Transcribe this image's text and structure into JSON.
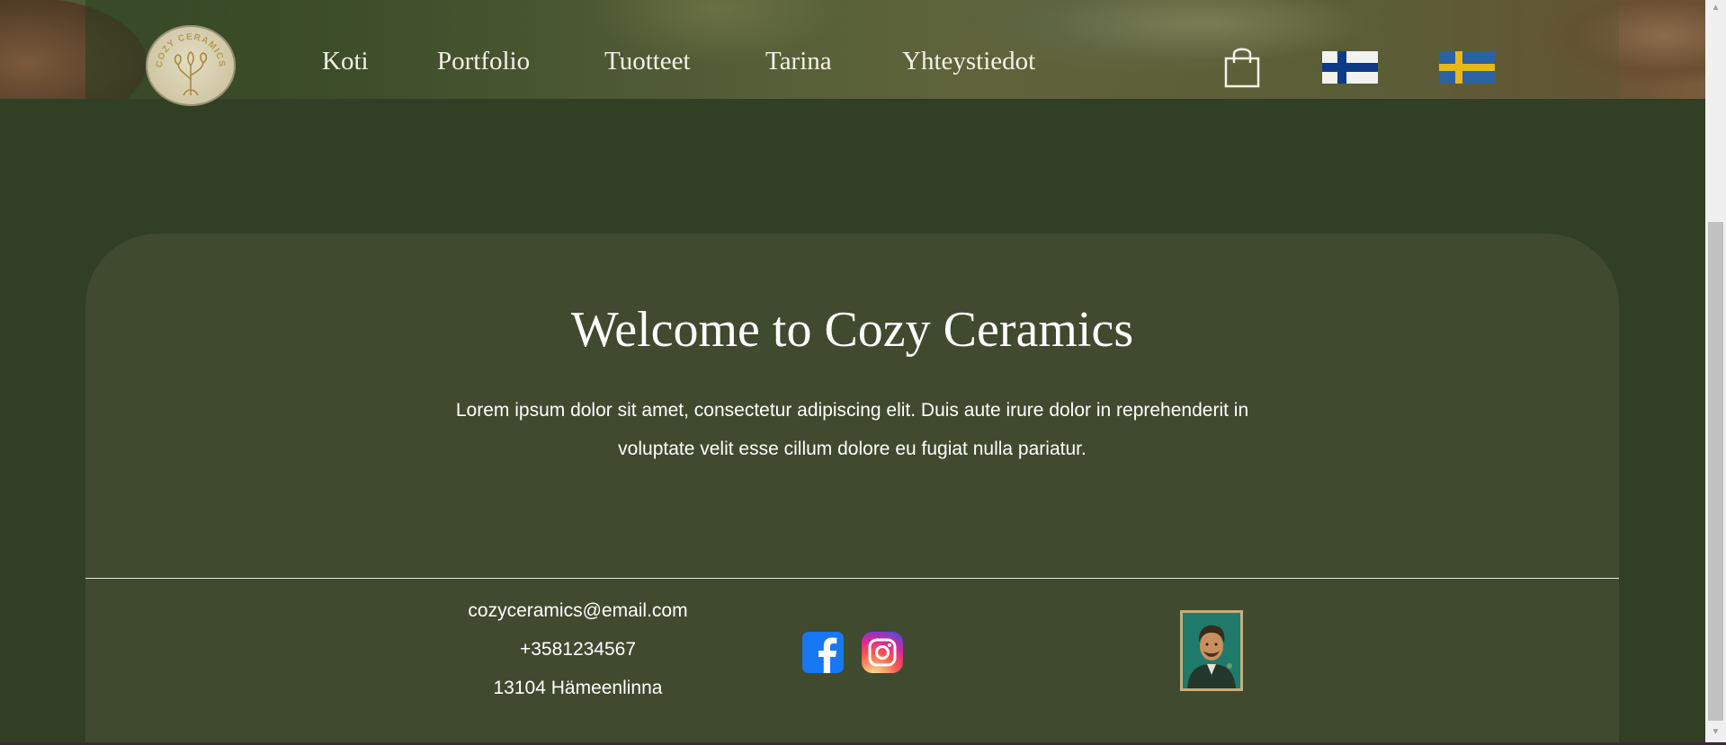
{
  "header": {
    "logo_text": "COZY CERAMICS",
    "nav": [
      {
        "label": "Koti"
      },
      {
        "label": "Portfolio"
      },
      {
        "label": "Tuotteet"
      },
      {
        "label": "Tarina"
      },
      {
        "label": "Yhteystiedot"
      }
    ],
    "icons": {
      "cart": "shopping-bag-icon",
      "lang_fi": "finland-flag-icon",
      "lang_se": "sweden-flag-icon"
    }
  },
  "main": {
    "title": "Welcome to Cozy Ceramics",
    "text": "Lorem ipsum dolor sit amet, consectetur adipiscing elit. Duis aute irure dolor in reprehenderit in voluptate velit esse cillum dolore eu fugiat nulla pariatur."
  },
  "footer": {
    "email": "cozyceramics@email.com",
    "phone": "+3581234567",
    "address": "13104 Hämeenlinna",
    "social": {
      "facebook": "facebook-icon",
      "instagram": "instagram-icon"
    }
  },
  "colors": {
    "background": "#313f25",
    "card": "#3f4a2e",
    "text": "#ffffff",
    "fi_blue": "#0f3b86",
    "se_blue": "#2a62a3",
    "se_yellow": "#e8b81a"
  }
}
